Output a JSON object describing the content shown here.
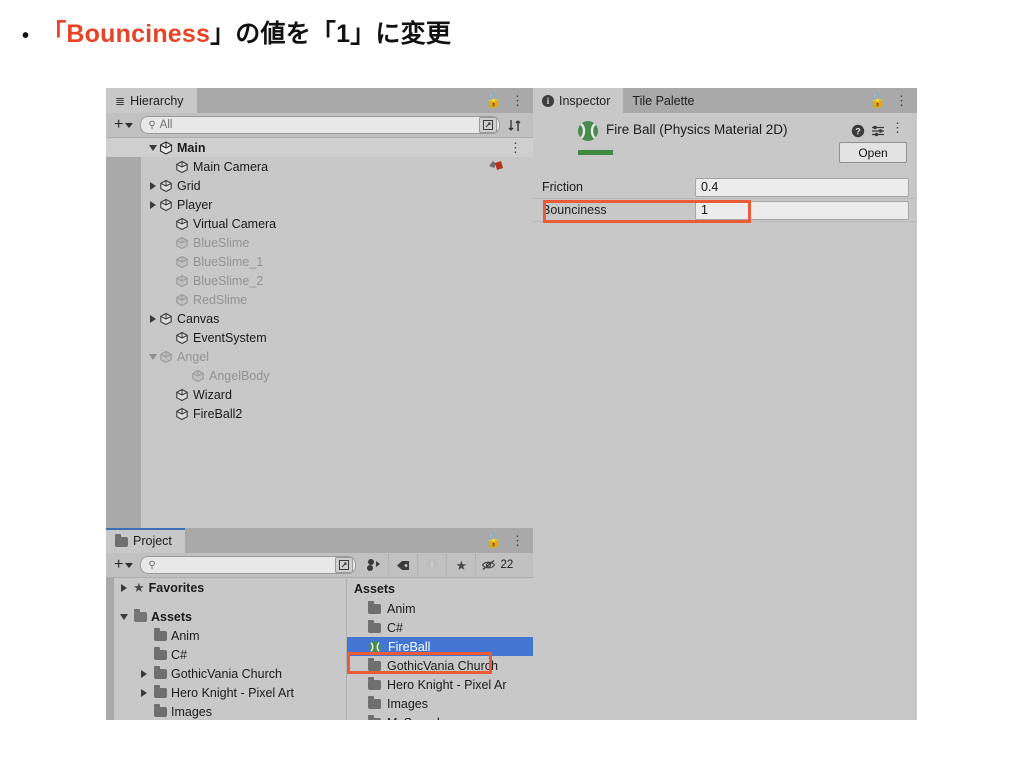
{
  "slide": {
    "bullet": "•",
    "text_before": "「",
    "highlight": "Bounciness",
    "text_mid": "」の値を「1」に変更"
  },
  "hierarchy": {
    "tab_label": "Hierarchy",
    "tab_icon": "hierarchy-list-icon",
    "lock_icon": "lock-open-icon",
    "menu_icon": "kebab-menu-icon",
    "toolbar": {
      "add_label": "+",
      "search_placeholder": "All",
      "search_value": "All",
      "search_icon": "search-icon",
      "save_search_icon": "save-search-icon",
      "sort_icon": "sort-icon"
    },
    "scene_row": {
      "label": "Main",
      "expanded": true,
      "menu_icon": "kebab-menu-icon"
    },
    "items": [
      {
        "label": "Main Camera",
        "indent": 2,
        "twisty": "none",
        "dim": false,
        "badge": "cinemachine-brain-icon"
      },
      {
        "label": "Grid",
        "indent": 1,
        "twisty": "right",
        "dim": false
      },
      {
        "label": "Player",
        "indent": 1,
        "twisty": "right",
        "dim": false
      },
      {
        "label": "Virtual Camera",
        "indent": 2,
        "twisty": "none",
        "dim": false
      },
      {
        "label": "BlueSlime",
        "indent": 2,
        "twisty": "none",
        "dim": true
      },
      {
        "label": "BlueSlime_1",
        "indent": 2,
        "twisty": "none",
        "dim": true
      },
      {
        "label": "BlueSlime_2",
        "indent": 2,
        "twisty": "none",
        "dim": true
      },
      {
        "label": "RedSlime",
        "indent": 2,
        "twisty": "none",
        "dim": true
      },
      {
        "label": "Canvas",
        "indent": 1,
        "twisty": "right",
        "dim": false
      },
      {
        "label": "EventSystem",
        "indent": 2,
        "twisty": "none",
        "dim": false
      },
      {
        "label": "Angel",
        "indent": 1,
        "twisty": "down",
        "dim": true
      },
      {
        "label": "AngelBody",
        "indent": 3,
        "twisty": "none",
        "dim": true
      },
      {
        "label": "Wizard",
        "indent": 2,
        "twisty": "none",
        "dim": false
      },
      {
        "label": "FireBall2",
        "indent": 2,
        "twisty": "none",
        "dim": false
      }
    ]
  },
  "inspector": {
    "tabs": [
      {
        "label": "Inspector",
        "active": true,
        "icon": "info-icon"
      },
      {
        "label": "Tile Palette",
        "active": false
      }
    ],
    "lock_icon": "lock-open-icon",
    "menu_icon": "kebab-menu-icon",
    "object_name": "Fire Ball (Physics Material 2D)",
    "object_icon": "physics-material-2d-icon",
    "help_icon": "help-icon",
    "preset_icon": "preset-icon",
    "header_menu_icon": "kebab-menu-icon",
    "open_button": "Open",
    "properties": [
      {
        "label": "Friction",
        "value": "0.4",
        "highlighted": false
      },
      {
        "label": "Bounciness",
        "value": "1",
        "highlighted": true
      }
    ]
  },
  "project": {
    "tab_label": "Project",
    "tab_icon": "folder-icon",
    "lock_icon": "lock-open-icon",
    "menu_icon": "kebab-menu-icon",
    "toolbar": {
      "add_label": "+",
      "search_placeholder": "",
      "search_icon": "search-icon",
      "save_search_icon": "save-search-icon",
      "type_filter_icon": "type-filter-icon",
      "label_filter_icon": "label-filter-icon",
      "warning_filter_icon": "warning-filter-icon",
      "favorite_filter_icon": "star-icon",
      "hidden_count_icon": "eye-off-icon",
      "hidden_count": "22"
    },
    "tree": [
      {
        "label": "Favorites",
        "indent": 0,
        "twisty": "right",
        "icon": "star-icon",
        "bold": true
      },
      {
        "label": "",
        "indent": 0,
        "twisty": "none",
        "icon": "none",
        "spacer": true
      },
      {
        "label": "Assets",
        "indent": 0,
        "twisty": "down",
        "icon": "folder-open-icon",
        "bold": true
      },
      {
        "label": "Anim",
        "indent": 1,
        "twisty": "none",
        "icon": "folder-icon"
      },
      {
        "label": "C#",
        "indent": 1,
        "twisty": "none",
        "icon": "folder-icon"
      },
      {
        "label": "GothicVania Church",
        "indent": 1,
        "twisty": "right",
        "icon": "folder-icon"
      },
      {
        "label": "Hero Knight - Pixel Art",
        "indent": 1,
        "twisty": "right",
        "icon": "folder-icon"
      },
      {
        "label": "Images",
        "indent": 1,
        "twisty": "none",
        "icon": "folder-icon"
      }
    ],
    "assets_header": "Assets",
    "assets": [
      {
        "label": "Anim",
        "icon": "folder-icon",
        "selected": false
      },
      {
        "label": "C#",
        "icon": "folder-icon",
        "selected": false
      },
      {
        "label": "FireBall",
        "icon": "physics-material-2d-icon",
        "selected": true
      },
      {
        "label": "GothicVania Church",
        "icon": "folder-icon",
        "selected": false
      },
      {
        "label": "Hero Knight - Pixel Ar",
        "icon": "folder-icon",
        "selected": false
      },
      {
        "label": "Images",
        "icon": "folder-icon",
        "selected": false
      },
      {
        "label": "MySounds",
        "icon": "folder-icon",
        "selected": false
      }
    ]
  },
  "colors": {
    "highlight_red": "#ec5b38",
    "selection_blue": "#4376d3",
    "panel_bg": "#c8c8c8",
    "tab_bg": "#a9a9a9",
    "physics_green": "#3f8a42"
  }
}
